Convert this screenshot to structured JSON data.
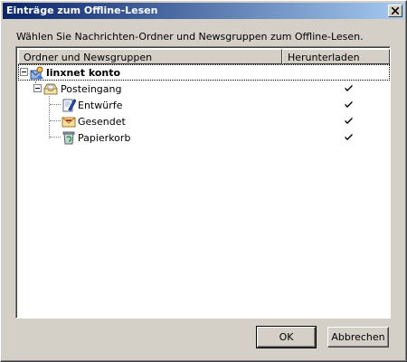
{
  "window": {
    "title": "Einträge zum Offline-Lesen"
  },
  "instruction": "Wählen Sie Nachrichten-Ordner und Newsgruppen zum Offline-Lesen.",
  "columns": {
    "name": "Ordner und Newsgruppen",
    "download": "Herunterladen"
  },
  "tree": [
    {
      "label": "linxnet konto",
      "icon": "account-icon",
      "expanded": true,
      "download": null
    },
    {
      "label": "Posteingang",
      "icon": "inbox-icon",
      "expanded": true,
      "download": true
    },
    {
      "label": "Entwürfe",
      "icon": "drafts-icon",
      "download": true
    },
    {
      "label": "Gesendet",
      "icon": "sent-icon",
      "download": true
    },
    {
      "label": "Papierkorb",
      "icon": "trash-icon",
      "download": true
    }
  ],
  "buttons": {
    "ok": "OK",
    "cancel": "Abbrechen"
  },
  "colors": {
    "titlebar_start": "#0a246a",
    "titlebar_end": "#a6caf0",
    "face": "#d4d0c8"
  }
}
